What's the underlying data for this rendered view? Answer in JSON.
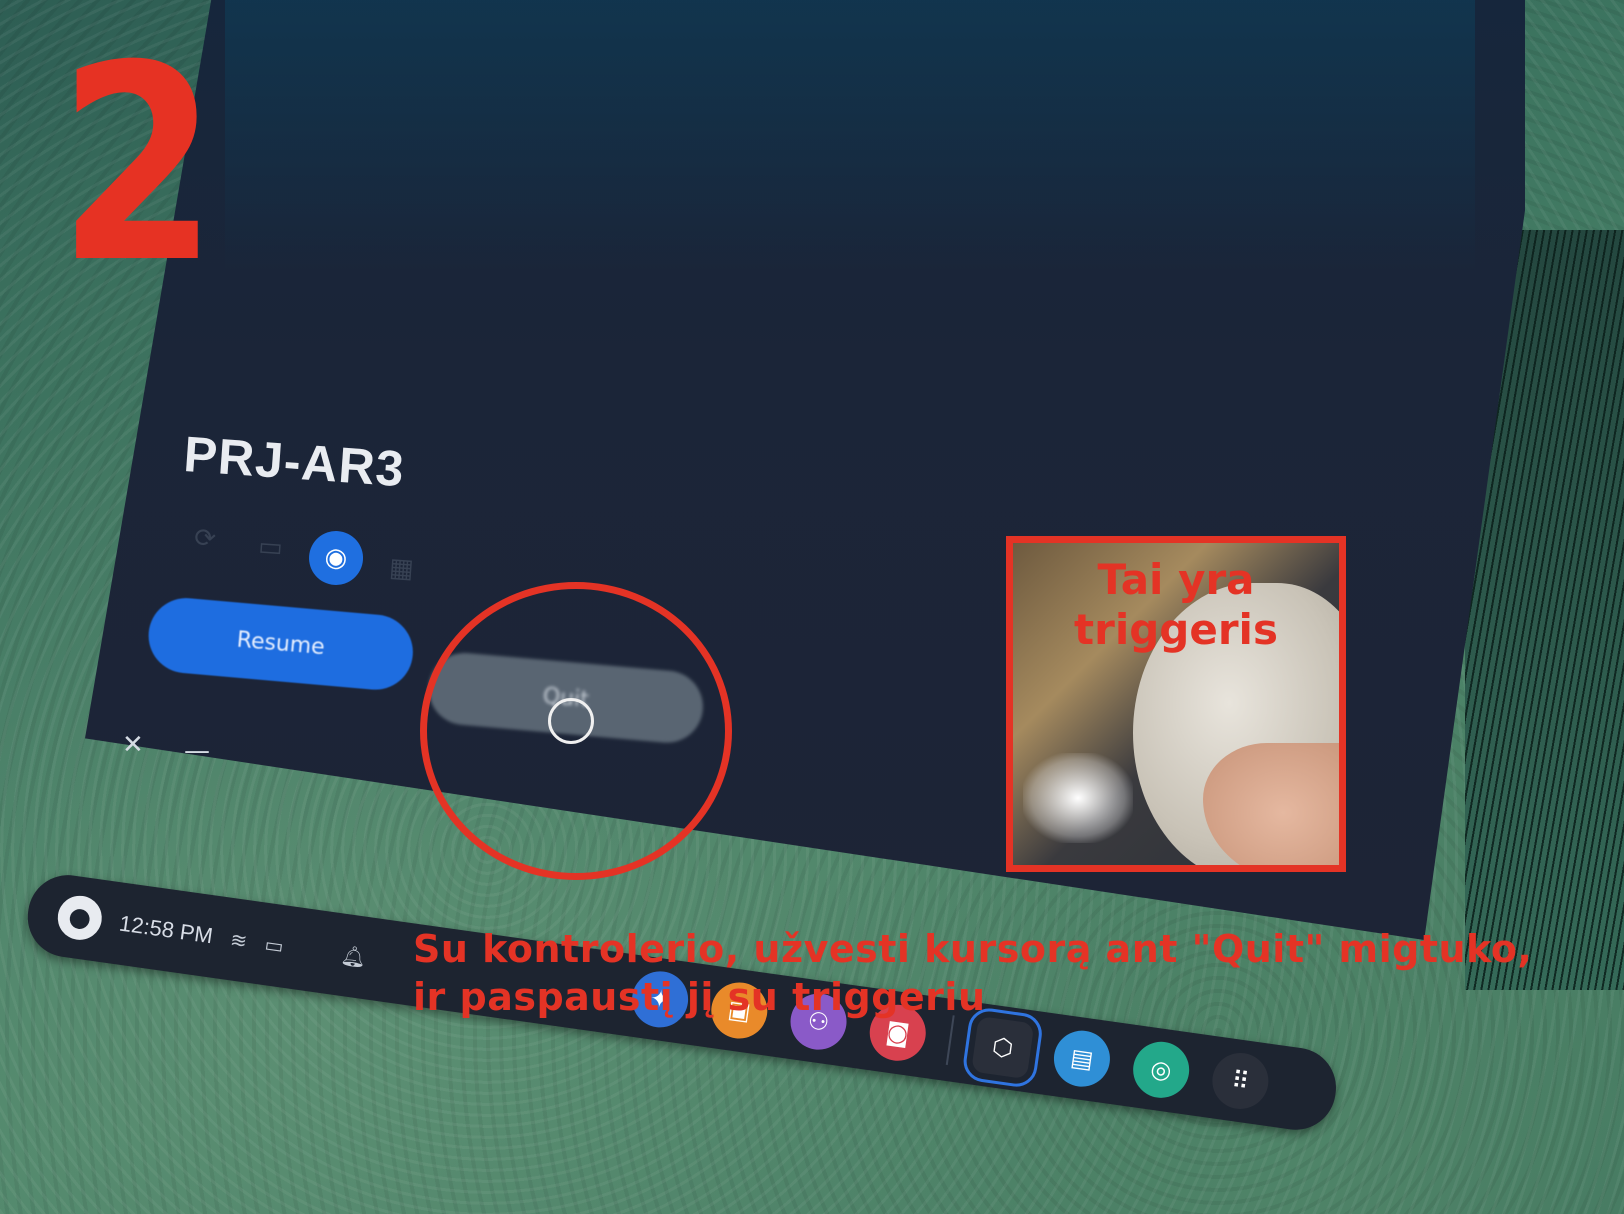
{
  "step": {
    "number": "2"
  },
  "app": {
    "title": "PRJ-AR3",
    "resume_label": "Resume",
    "quit_label": "Quit",
    "close_symbol": "✕",
    "minimize_symbol": "—",
    "mode_icons": [
      "refresh-icon",
      "video-icon",
      "cast-icon",
      "grid-icon"
    ]
  },
  "inset": {
    "label_line1": "Tai yra",
    "label_line2": "triggeris"
  },
  "instruction": {
    "line1": "Su kontrolerio, užvesti kursorą ant \"Quit\" migtuko,",
    "line2": "ir paspaustį jį su triggeriu"
  },
  "taskbar": {
    "time": "12:58 PM",
    "apps": [
      "explore-icon",
      "store-icon",
      "people-icon",
      "camera-icon",
      "unity-icon",
      "files-icon",
      "browser-icon",
      "app-grid-icon"
    ]
  },
  "colors": {
    "annotation": "#e43325",
    "accent": "#1e6de0",
    "window_bg": "#1b2538"
  }
}
